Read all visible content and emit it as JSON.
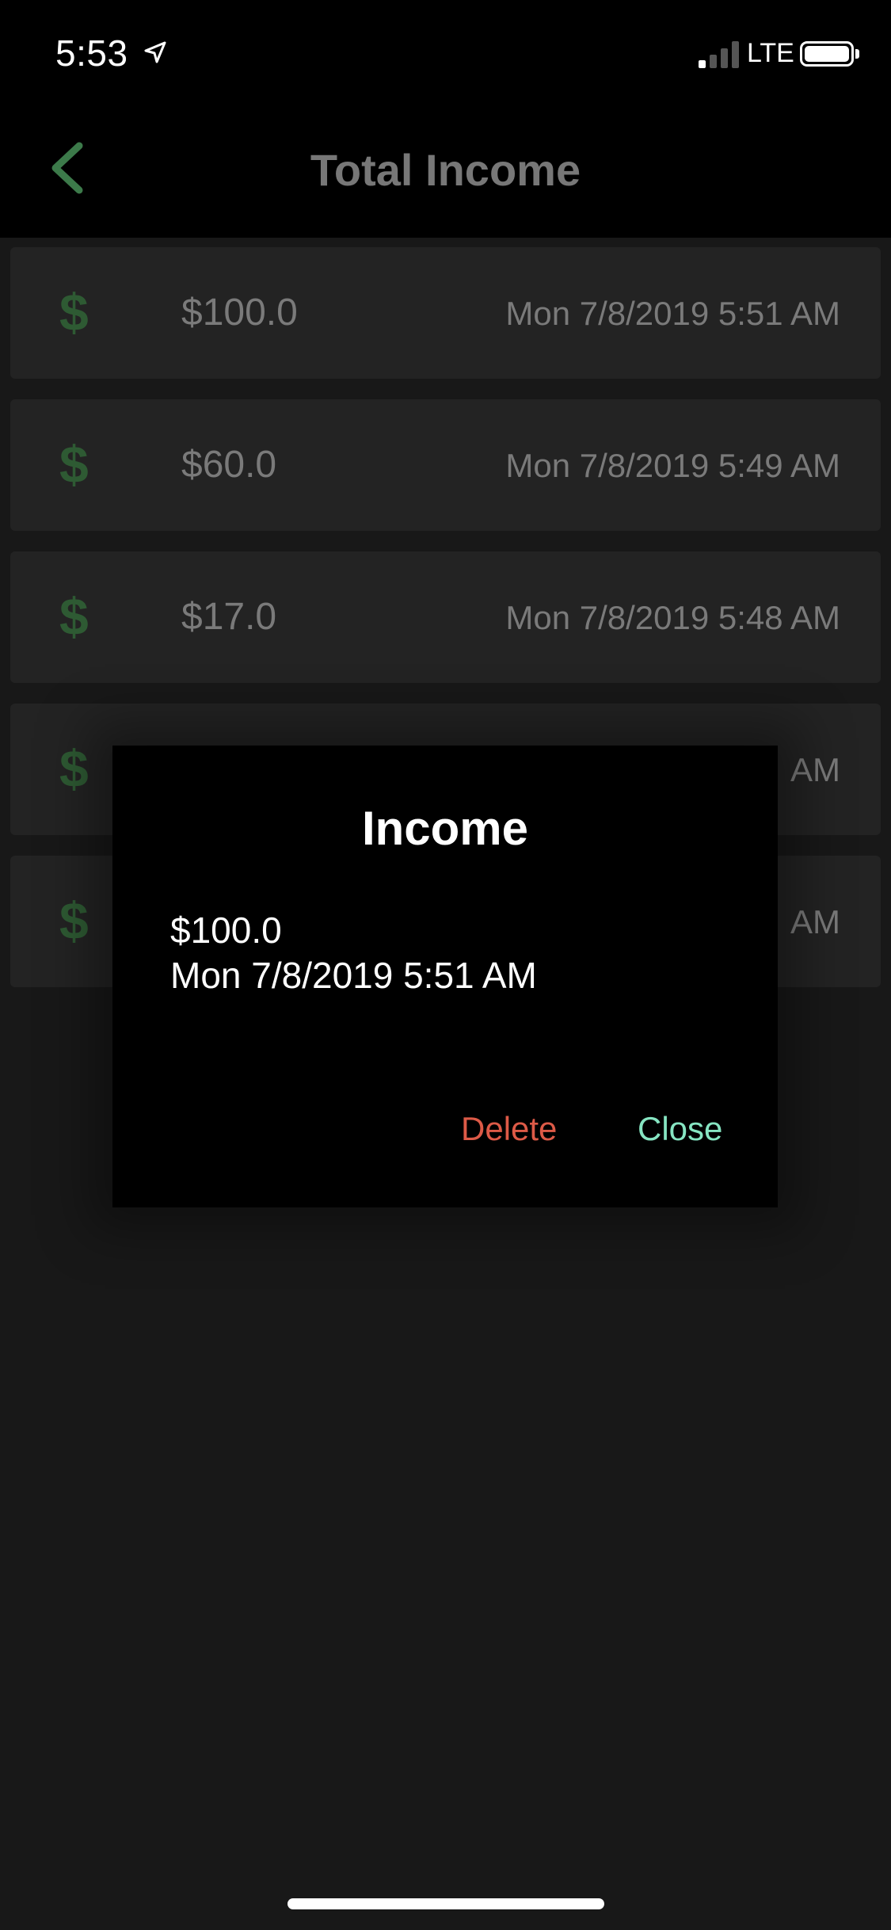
{
  "status_bar": {
    "time": "5:53",
    "network": "LTE"
  },
  "header": {
    "title": "Total Income"
  },
  "incomes": [
    {
      "amount": "$100.0",
      "date": "Mon 7/8/2019 5:51 AM"
    },
    {
      "amount": "$60.0",
      "date": "Mon 7/8/2019 5:49 AM"
    },
    {
      "amount": "$17.0",
      "date": "Mon 7/8/2019 5:48 AM"
    },
    {
      "amount": "",
      "date": "AM"
    },
    {
      "amount": "",
      "date": "AM"
    }
  ],
  "list_icon": "$",
  "dialog": {
    "title": "Income",
    "amount": "$100.0",
    "date": "Mon 7/8/2019 5:51 AM",
    "delete_label": "Delete",
    "close_label": "Close"
  },
  "icons": {
    "back": "chevron-left-icon",
    "location": "location-arrow-icon",
    "signal": "cellular-signal-icon",
    "battery": "battery-icon"
  },
  "colors": {
    "accent_green": "#3c7a4a",
    "dollar_green": "#2e5a33",
    "delete_red": "#dd5a47",
    "close_mint": "#86e5c2"
  }
}
